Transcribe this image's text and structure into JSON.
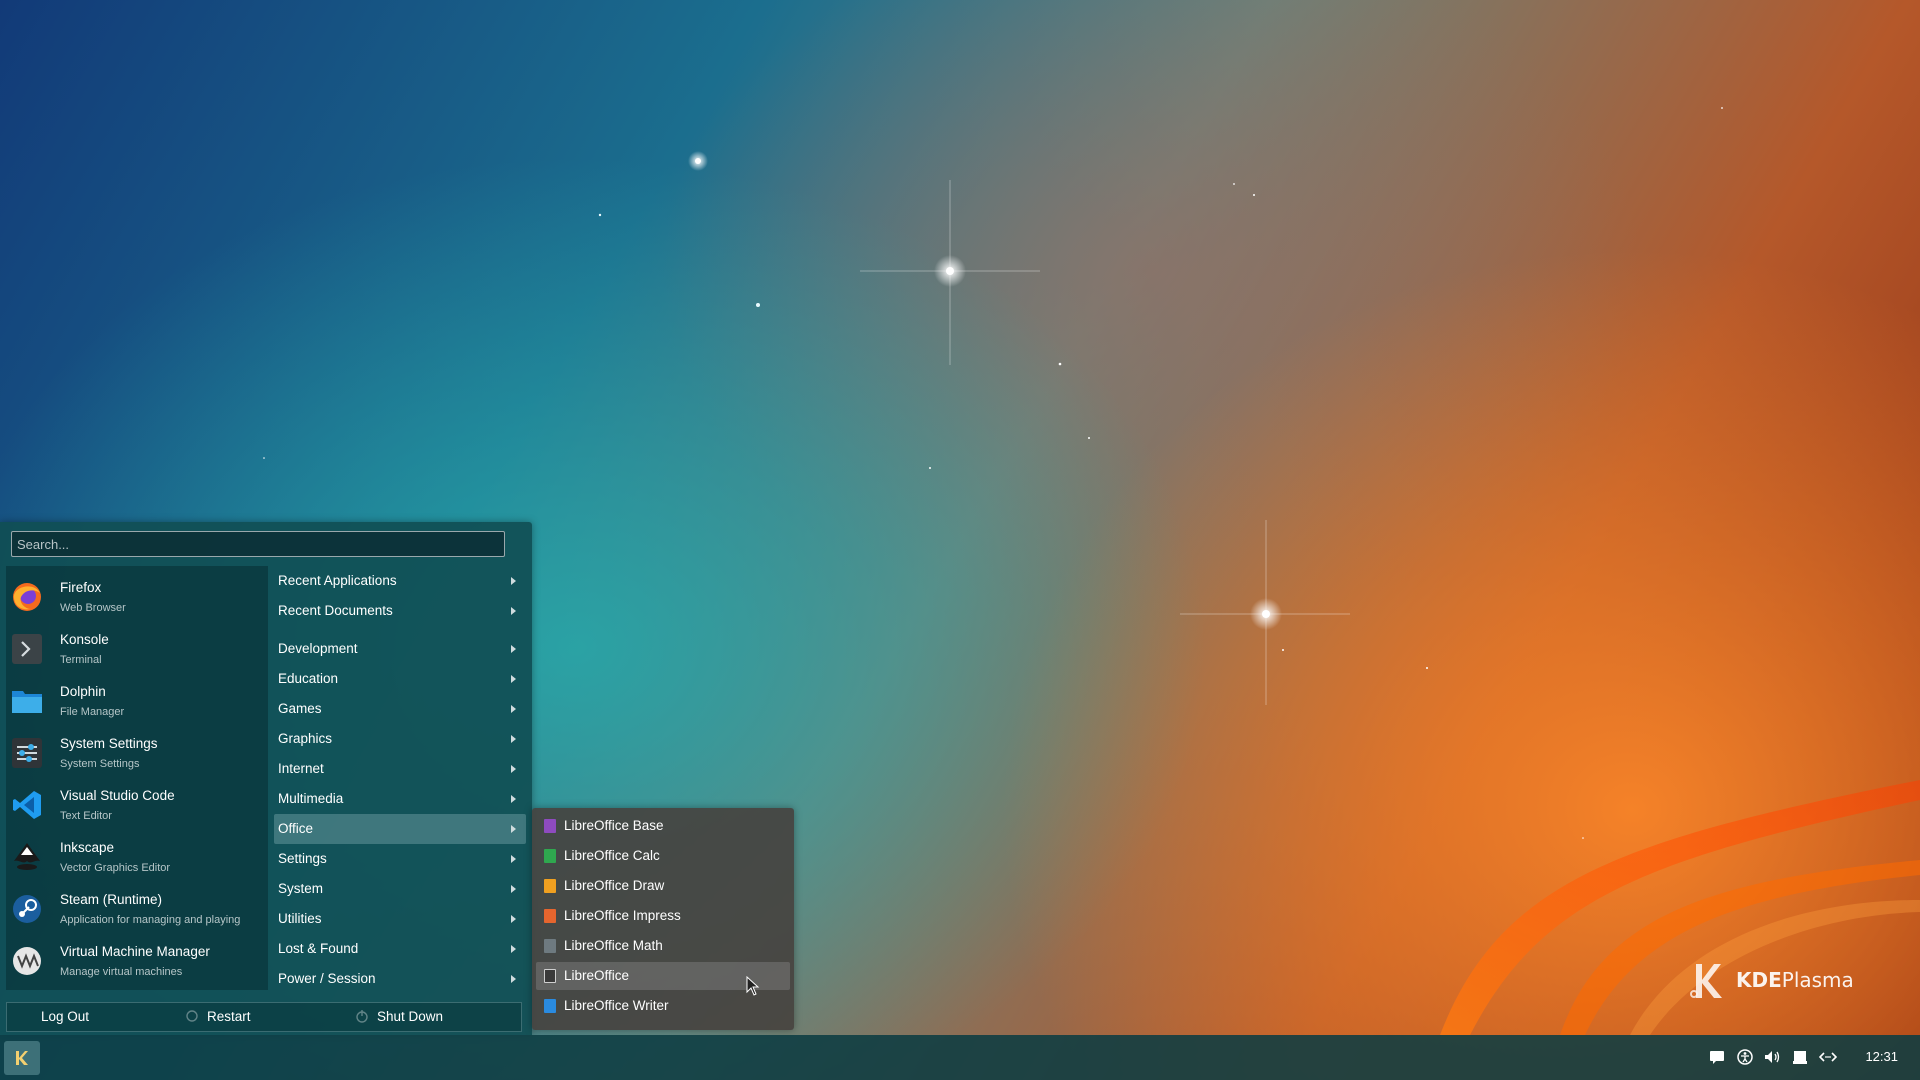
{
  "search": {
    "placeholder": "Search..."
  },
  "favorites": [
    {
      "name": "Firefox",
      "desc": "Web Browser",
      "icon": "firefox-icon"
    },
    {
      "name": "Konsole",
      "desc": "Terminal",
      "icon": "konsole-icon"
    },
    {
      "name": "Dolphin",
      "desc": "File Manager",
      "icon": "dolphin-icon"
    },
    {
      "name": "System Settings",
      "desc": "System Settings",
      "icon": "system-settings-icon"
    },
    {
      "name": "Visual Studio Code",
      "desc": "Text Editor",
      "icon": "vscode-icon"
    },
    {
      "name": "Inkscape",
      "desc": "Vector Graphics Editor",
      "icon": "inkscape-icon"
    },
    {
      "name": "Steam (Runtime)",
      "desc": "Application for managing and playing",
      "icon": "steam-icon"
    },
    {
      "name": "Virtual Machine Manager",
      "desc": "Manage virtual machines",
      "icon": "virt-manager-icon"
    }
  ],
  "categories": [
    "Recent Applications",
    "Recent Documents",
    "Development",
    "Education",
    "Games",
    "Graphics",
    "Internet",
    "Multimedia",
    "Office",
    "Settings",
    "System",
    "Utilities",
    "Lost & Found",
    "Power / Session"
  ],
  "active_category": "Office",
  "office_submenu": [
    {
      "label": "LibreOffice Base",
      "color": "#8e4bbf"
    },
    {
      "label": "LibreOffice Calc",
      "color": "#2fa84f"
    },
    {
      "label": "LibreOffice Draw",
      "color": "#f0a020"
    },
    {
      "label": "LibreOffice Impress",
      "color": "#e5652e"
    },
    {
      "label": "LibreOffice Math",
      "color": "#6e7a80"
    },
    {
      "label": "LibreOffice",
      "color": "#3a3a3a"
    },
    {
      "label": "LibreOffice Writer",
      "color": "#2a8be0"
    }
  ],
  "hovered_submenu_item": "LibreOffice",
  "power": {
    "logout": "Log Out",
    "restart": "Restart",
    "shutdown": "Shut Down"
  },
  "taskbar": {
    "clock": "12:31"
  },
  "branding": {
    "kde": "KDE",
    "plasma": "Plasma"
  }
}
